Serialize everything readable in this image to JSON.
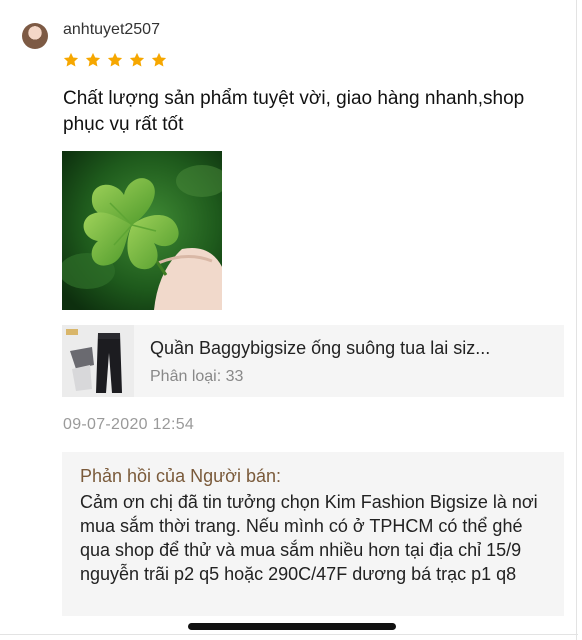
{
  "review": {
    "username": "anhtuyet2507",
    "rating": 5,
    "text": "Chất lượng sản phẩm tuyệt vời, giao hàng nhanh,shop phục vụ rất tốt",
    "date": "09-07-2020 12:54"
  },
  "product": {
    "name": "Quần Baggybigsize ống suông tua lai siz...",
    "variation_label": "Phân loại:",
    "variation_value": "33"
  },
  "seller_reply": {
    "title": "Phản hồi của Người bán:",
    "text": "Cảm ơn chị đã tin tưởng chọn Kim Fashion Bigsize là nơi mua sắm thời trang. Nếu mình có ở TPHCM có thể ghé qua shop để thử và mua sắm nhiều hơn tại địa chỉ 15/9 nguyễn trãi p2 q5 hoặc 290C/47F dương bá trạc p1 q8"
  },
  "colors": {
    "star": "#f6a700",
    "reply_title": "#7a5a3a"
  },
  "icons": {
    "star": "star-icon"
  }
}
